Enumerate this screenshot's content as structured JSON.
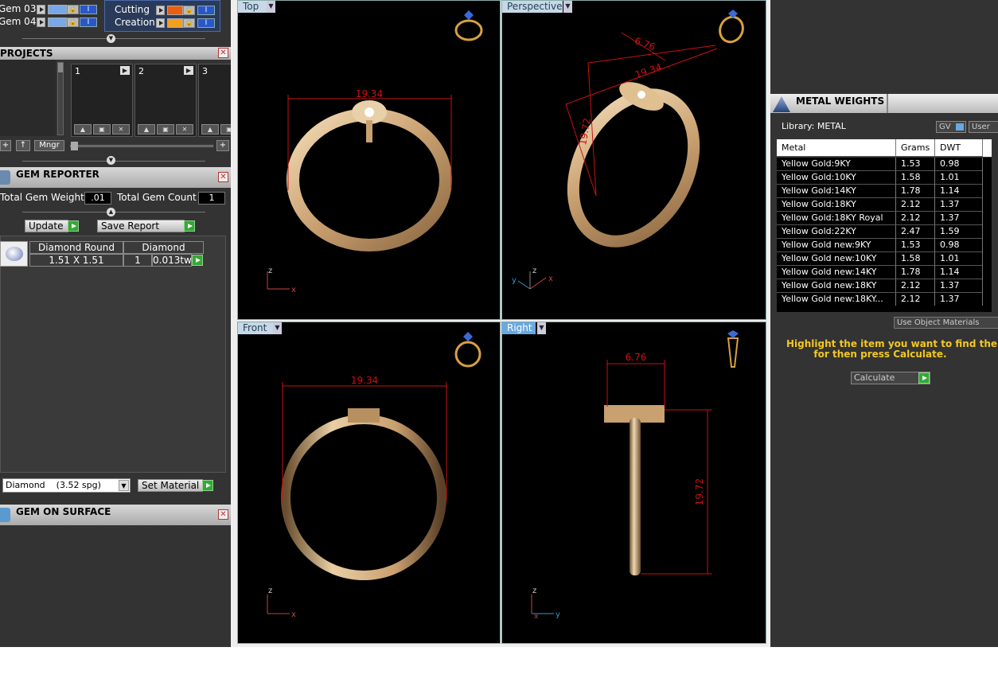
{
  "layers": [
    {
      "name": "Gem 03",
      "swatch": "#78a8e8"
    },
    {
      "name": "Gem 04",
      "swatch": "#78a8e8"
    }
  ],
  "layers2": [
    {
      "name": "Cutting",
      "swatch": "#e86010"
    },
    {
      "name": "Creation",
      "swatch": "#f0a020"
    }
  ],
  "projects": {
    "title": "PROJECTS",
    "slots": [
      "1",
      "2",
      "3"
    ],
    "mngr_label": "Mngr"
  },
  "gem_reporter": {
    "title": "GEM REPORTER",
    "total_weight_label": "Total Gem Weight",
    "total_weight_value": ".01",
    "total_count_label": "Total Gem Count",
    "total_count_value": "1",
    "update_label": "Update",
    "save_report_label": "Save Report",
    "table_headers": [
      "Diamond Round",
      "Diamond"
    ],
    "row": {
      "size": "1.51 X 1.51",
      "qty": "1",
      "weight": "0.013tw"
    },
    "material_select": "Diamond    (3.52 spg)",
    "set_material_label": "Set Material"
  },
  "gem_on_surface": {
    "title": "GEM ON SURFACE"
  },
  "viewports": {
    "top": {
      "label": "Top",
      "dim": "19.34"
    },
    "perspective": {
      "label": "Perspective",
      "dim1": "6.76",
      "dim2": "19.34",
      "dim3": "19.72"
    },
    "front": {
      "label": "Front",
      "dim": "19.34"
    },
    "right": {
      "label": "Right",
      "dim1": "6.76",
      "dim2": "19.72"
    }
  },
  "metal_weights": {
    "title": "METAL WEIGHTS",
    "library_label": "Library: METAL",
    "gv_label": "GV",
    "user_label": "User",
    "headers": [
      "Metal",
      "Grams",
      "DWT"
    ],
    "rows": [
      [
        "Yellow Gold:9KY",
        "1.53",
        "0.98"
      ],
      [
        "Yellow Gold:10KY",
        "1.58",
        "1.01"
      ],
      [
        "Yellow Gold:14KY",
        "1.78",
        "1.14"
      ],
      [
        "Yellow Gold:18KY",
        "2.12",
        "1.37"
      ],
      [
        "Yellow Gold:18KY Royal",
        "2.12",
        "1.37"
      ],
      [
        "Yellow Gold:22KY",
        "2.47",
        "1.59"
      ],
      [
        "Yellow Gold new:9KY",
        "1.53",
        "0.98"
      ],
      [
        "Yellow Gold new:10KY",
        "1.58",
        "1.01"
      ],
      [
        "Yellow Gold new:14KY",
        "1.78",
        "1.14"
      ],
      [
        "Yellow Gold new:18KY",
        "2.12",
        "1.37"
      ],
      [
        "Yellow Gold new:18KY...",
        "2.12",
        "1.37"
      ]
    ],
    "use_object_materials": "Use Object Materials",
    "hint_line1": "Highlight the item you want to find the weight",
    "hint_line2": "for then press Calculate.",
    "calculate_label": "Calculate"
  }
}
